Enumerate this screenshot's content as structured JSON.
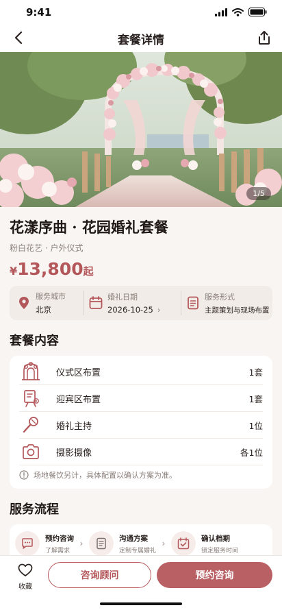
{
  "status_bar": {
    "time": "9:41"
  },
  "nav": {
    "title": "套餐详情"
  },
  "gallery": {
    "counter": "1/5"
  },
  "package": {
    "title": "花漾序曲 · 花园婚礼套餐",
    "subtitle": "粉白花艺 · 户外仪式",
    "price": {
      "currency": "¥",
      "amount": "13,800",
      "suffix": "起"
    }
  },
  "facts": [
    {
      "label": "服务城市",
      "value": "北京",
      "icon": "location-icon"
    },
    {
      "label": "婚礼日期",
      "value": "2026-10-25",
      "icon": "calendar-icon"
    },
    {
      "label": "服务形式",
      "value": "主题策划与现场布置",
      "icon": "document-icon"
    }
  ],
  "contents": {
    "heading": "套餐内容",
    "items": [
      {
        "name": "仪式区布置",
        "qty": "1套",
        "icon": "floral-arch-icon"
      },
      {
        "name": "迎宾区布置",
        "qty": "1套",
        "icon": "welcome-sign-icon"
      },
      {
        "name": "婚礼主持",
        "qty": "1位",
        "icon": "microphone-icon"
      },
      {
        "name": "摄影摄像",
        "qty": "各1位",
        "icon": "camera-icon"
      }
    ],
    "note": "场地餐饮另计，具体配置以确认方案为准。"
  },
  "process": {
    "heading": "服务流程",
    "steps": [
      {
        "title": "预约咨询",
        "desc": "了解需求",
        "icon": "chat-icon"
      },
      {
        "title": "沟通方案",
        "desc": "定制专属婚礼",
        "icon": "plan-icon"
      },
      {
        "title": "确认档期",
        "desc": "锁定服务时间",
        "icon": "calendar-check-icon"
      }
    ]
  },
  "bottom": {
    "favorite": "收藏",
    "consult": "咨询顾问",
    "book": "预约咨询"
  },
  "colors": {
    "accent": "#b4575a",
    "button": "#b96065",
    "background": "#f8f5f2"
  }
}
